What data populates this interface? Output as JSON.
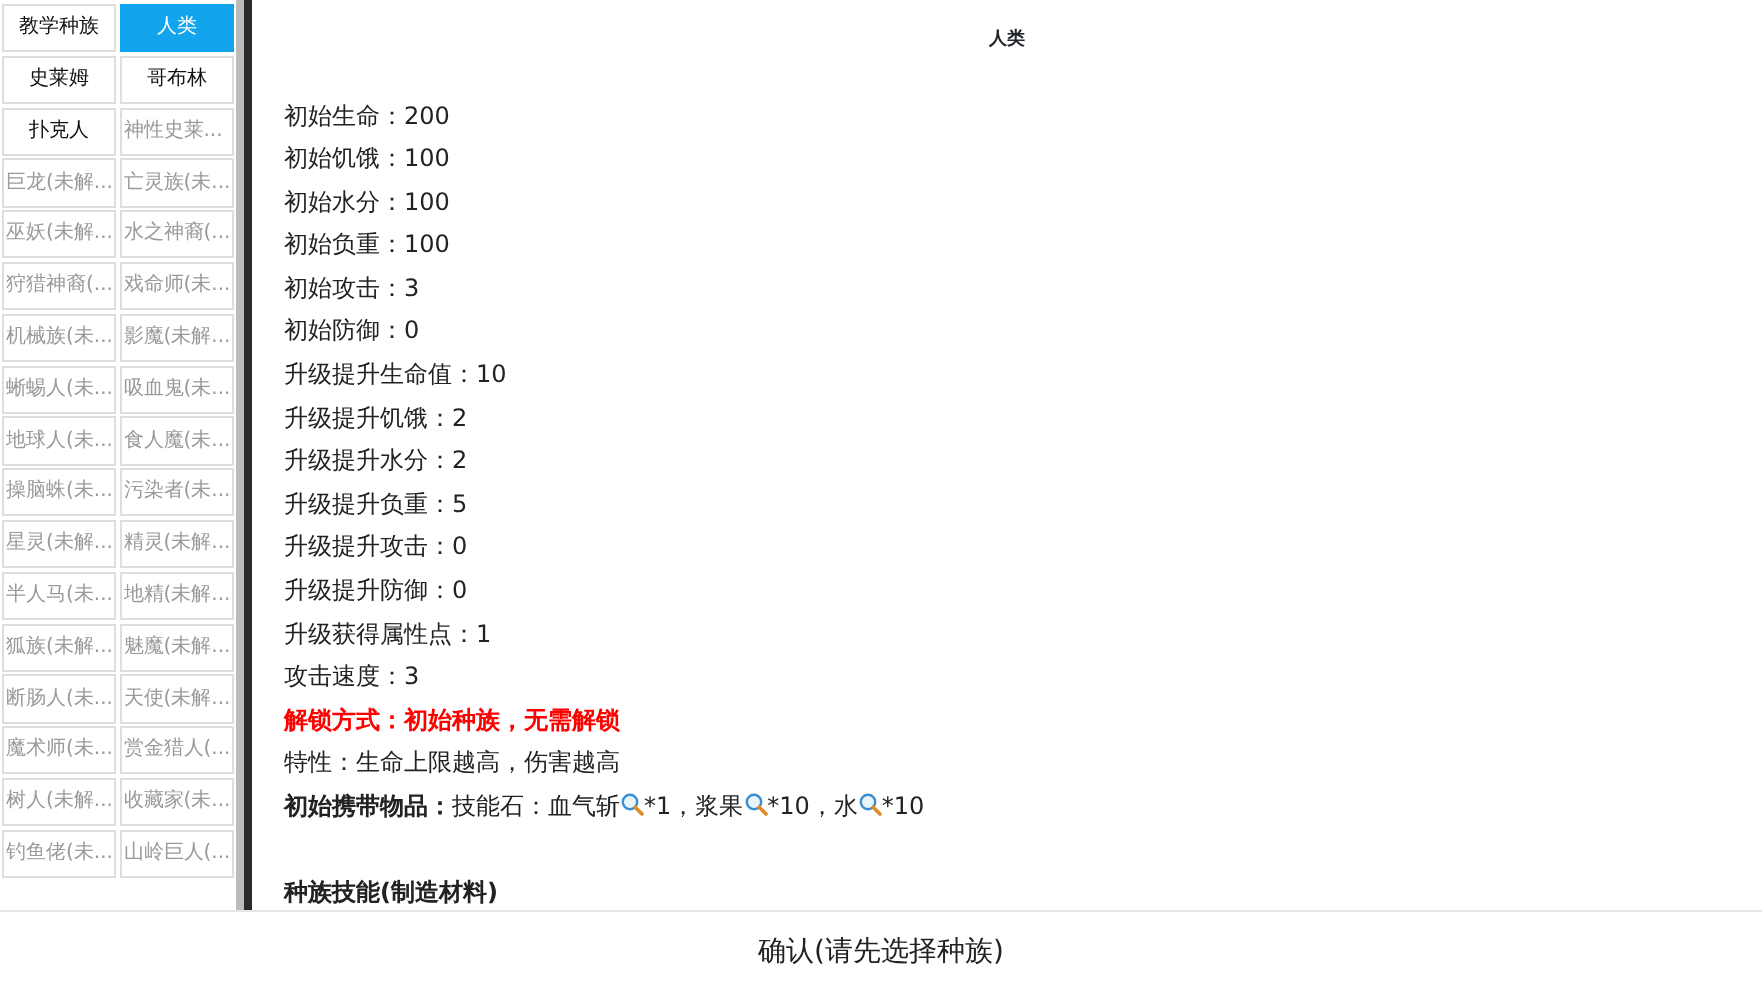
{
  "races": [
    {
      "label": "教学种族",
      "selected": false,
      "locked": false
    },
    {
      "label": "人类",
      "selected": true,
      "locked": false
    },
    {
      "label": "史莱姆",
      "selected": false,
      "locked": false
    },
    {
      "label": "哥布林",
      "selected": false,
      "locked": false
    },
    {
      "label": "扑克人",
      "selected": false,
      "locked": false
    },
    {
      "label": "神性史莱...",
      "selected": false,
      "locked": true
    },
    {
      "label": "巨龙(未解...",
      "selected": false,
      "locked": true
    },
    {
      "label": "亡灵族(未...",
      "selected": false,
      "locked": true
    },
    {
      "label": "巫妖(未解...",
      "selected": false,
      "locked": true
    },
    {
      "label": "水之神裔(...",
      "selected": false,
      "locked": true
    },
    {
      "label": "狩猎神裔(...",
      "selected": false,
      "locked": true
    },
    {
      "label": "戏命师(未...",
      "selected": false,
      "locked": true
    },
    {
      "label": "机械族(未...",
      "selected": false,
      "locked": true
    },
    {
      "label": "影魔(未解...",
      "selected": false,
      "locked": true
    },
    {
      "label": "蜥蜴人(未...",
      "selected": false,
      "locked": true
    },
    {
      "label": "吸血鬼(未...",
      "selected": false,
      "locked": true
    },
    {
      "label": "地球人(未...",
      "selected": false,
      "locked": true
    },
    {
      "label": "食人魔(未...",
      "selected": false,
      "locked": true
    },
    {
      "label": "操脑蛛(未...",
      "selected": false,
      "locked": true
    },
    {
      "label": "污染者(未...",
      "selected": false,
      "locked": true
    },
    {
      "label": "星灵(未解...",
      "selected": false,
      "locked": true
    },
    {
      "label": "精灵(未解...",
      "selected": false,
      "locked": true
    },
    {
      "label": "半人马(未...",
      "selected": false,
      "locked": true
    },
    {
      "label": "地精(未解...",
      "selected": false,
      "locked": true
    },
    {
      "label": "狐族(未解...",
      "selected": false,
      "locked": true
    },
    {
      "label": "魅魔(未解...",
      "selected": false,
      "locked": true
    },
    {
      "label": "断肠人(未...",
      "selected": false,
      "locked": true
    },
    {
      "label": "天使(未解...",
      "selected": false,
      "locked": true
    },
    {
      "label": "魔术师(未...",
      "selected": false,
      "locked": true
    },
    {
      "label": "赏金猎人(...",
      "selected": false,
      "locked": true
    },
    {
      "label": "树人(未解...",
      "selected": false,
      "locked": true
    },
    {
      "label": "收藏家(未...",
      "selected": false,
      "locked": true
    },
    {
      "label": "钓鱼佬(未...",
      "selected": false,
      "locked": true
    },
    {
      "label": "山岭巨人(...",
      "selected": false,
      "locked": true
    }
  ],
  "detail": {
    "title": "人类",
    "lines": [
      {
        "kind": "stat",
        "text": "初始生命：200"
      },
      {
        "kind": "stat",
        "text": "初始饥饿：100"
      },
      {
        "kind": "stat",
        "text": "初始水分：100"
      },
      {
        "kind": "stat",
        "text": "初始负重：100"
      },
      {
        "kind": "stat",
        "text": "初始攻击：3"
      },
      {
        "kind": "stat",
        "text": "初始防御：0"
      },
      {
        "kind": "stat",
        "text": "升级提升生命值：10"
      },
      {
        "kind": "stat",
        "text": "升级提升饥饿：2"
      },
      {
        "kind": "stat",
        "text": "升级提升水分：2"
      },
      {
        "kind": "stat",
        "text": "升级提升负重：5"
      },
      {
        "kind": "stat",
        "text": "升级提升攻击：0"
      },
      {
        "kind": "stat",
        "text": "升级提升防御：0"
      },
      {
        "kind": "stat",
        "text": "升级获得属性点：1"
      },
      {
        "kind": "stat",
        "text": "攻击速度：3"
      },
      {
        "kind": "unlock",
        "text": "解锁方式：初始种族，无需解锁"
      },
      {
        "kind": "stat",
        "text": "特性：生命上限越高，伤害越高"
      },
      {
        "kind": "items",
        "label": "初始携带物品：",
        "entries": [
          {
            "name": "技能石：血气斩",
            "count": "*1，"
          },
          {
            "name": "浆果",
            "count": "*10，"
          },
          {
            "name": "水",
            "count": "*10"
          }
        ]
      },
      {
        "kind": "gap"
      },
      {
        "kind": "heading",
        "text": "种族技能(制造材料)"
      }
    ]
  },
  "confirm": "确认(请先选择种族)"
}
